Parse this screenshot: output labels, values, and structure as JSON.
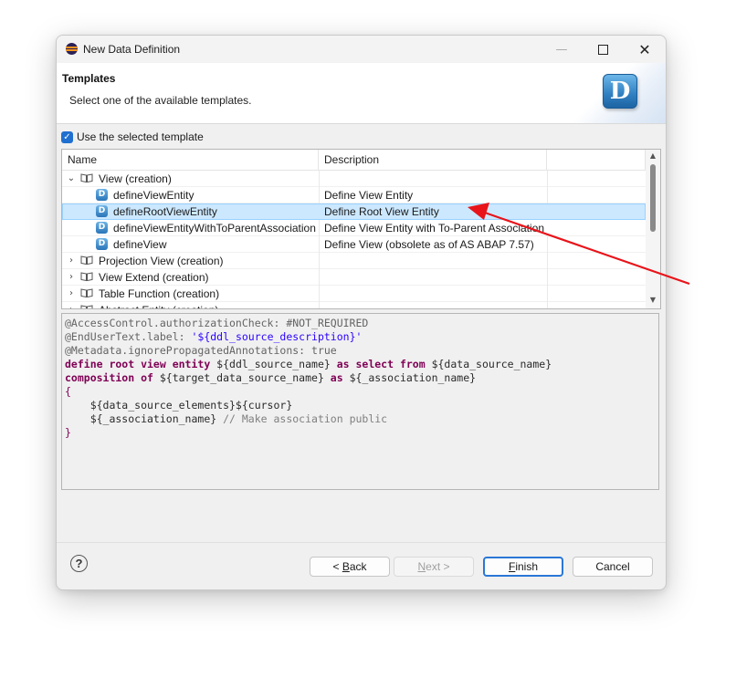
{
  "window": {
    "title": "New Data Definition"
  },
  "header": {
    "title": "Templates",
    "description": "Select one of the available templates.",
    "logo_letter": "D"
  },
  "use_template": {
    "label": "Use the selected template",
    "checked": true
  },
  "tree": {
    "columns": [
      "Name",
      "Description",
      ""
    ],
    "rows": [
      {
        "type": "group",
        "expanded": true,
        "label": "View (creation)",
        "description": ""
      },
      {
        "type": "item",
        "label": "defineViewEntity",
        "description": "Define View Entity"
      },
      {
        "type": "item",
        "label": "defineRootViewEntity",
        "description": "Define Root View Entity",
        "selected": true
      },
      {
        "type": "item",
        "label": "defineViewEntityWithToParentAssociation",
        "description": "Define View Entity with To-Parent Association"
      },
      {
        "type": "item",
        "label": "defineView",
        "description": "Define View (obsolete as of AS ABAP 7.57)"
      },
      {
        "type": "group",
        "expanded": false,
        "label": "Projection View (creation)",
        "description": ""
      },
      {
        "type": "group",
        "expanded": false,
        "label": "View Extend (creation)",
        "description": ""
      },
      {
        "type": "group",
        "expanded": false,
        "label": "Table Function (creation)",
        "description": ""
      },
      {
        "type": "group",
        "expanded": false,
        "label": "Abstract Entity (creation)",
        "description": ""
      }
    ]
  },
  "code": {
    "line1_ann": "@AccessControl.authorizationCheck: #NOT_REQUIRED",
    "line2_ann": "@EndUserText.label: ",
    "line2_str": "'${ddl_source_description}'",
    "line3_ann": "@Metadata.ignorePropagatedAnnotations: true",
    "line4_kw1": "define root view entity ",
    "line4_var1": "${ddl_source_name}",
    "line4_kw2": " as select from ",
    "line4_var2": "${data_source_name}",
    "line5_kw1": "composition of ",
    "line5_var1": "${target_data_source_name}",
    "line5_kw2": " as ",
    "line5_var2": "${_association_name}",
    "line6": "{",
    "line7": "    ${data_source_elements}${cursor}",
    "line8_var": "    ${_association_name}",
    "line8_cmt": " // Make association public",
    "line9": "}"
  },
  "buttons": {
    "help": "?",
    "back_prefix": "< ",
    "back_mnemonic": "B",
    "back_rest": "ack",
    "next_mnemonic": "N",
    "next_rest": "ext >",
    "finish_mnemonic": "F",
    "finish_rest": "inish",
    "cancel": "Cancel"
  },
  "colors": {
    "selection": "#cce8ff",
    "accent": "#2a77d6",
    "arrow": "#e8141a"
  }
}
